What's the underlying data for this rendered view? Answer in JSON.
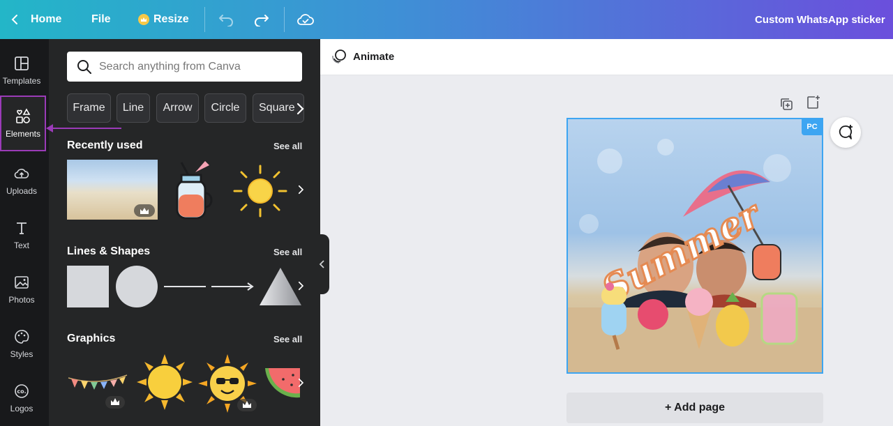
{
  "topbar": {
    "home_label": "Home",
    "file_label": "File",
    "resize_label": "Resize",
    "title": "Custom WhatsApp sticker"
  },
  "rail": {
    "items": [
      {
        "label": "Templates",
        "icon": "templates-icon"
      },
      {
        "label": "Elements",
        "icon": "elements-icon",
        "active": true
      },
      {
        "label": "Uploads",
        "icon": "upload-cloud-icon"
      },
      {
        "label": "Text",
        "icon": "text-icon"
      },
      {
        "label": "Photos",
        "icon": "photos-icon"
      },
      {
        "label": "Styles",
        "icon": "palette-icon"
      },
      {
        "label": "Logos",
        "icon": "logo-icon"
      }
    ]
  },
  "panel": {
    "search_placeholder": "Search anything from Canva",
    "chips": [
      "Frame",
      "Line",
      "Arrow",
      "Circle",
      "Square"
    ],
    "sections": {
      "recent": {
        "title": "Recently used",
        "see_all": "See all"
      },
      "shapes": {
        "title": "Lines & Shapes",
        "see_all": "See all"
      },
      "graphics": {
        "title": "Graphics",
        "see_all": "See all"
      }
    }
  },
  "editor": {
    "animate_label": "Animate",
    "badge": "PC",
    "add_page_label": "+ Add page",
    "design_text": "Summer"
  },
  "colors": {
    "accent": "#3da5f2",
    "active_outline": "#9b3bb8",
    "panel_bg": "#252627",
    "rail_bg": "#18191b"
  }
}
